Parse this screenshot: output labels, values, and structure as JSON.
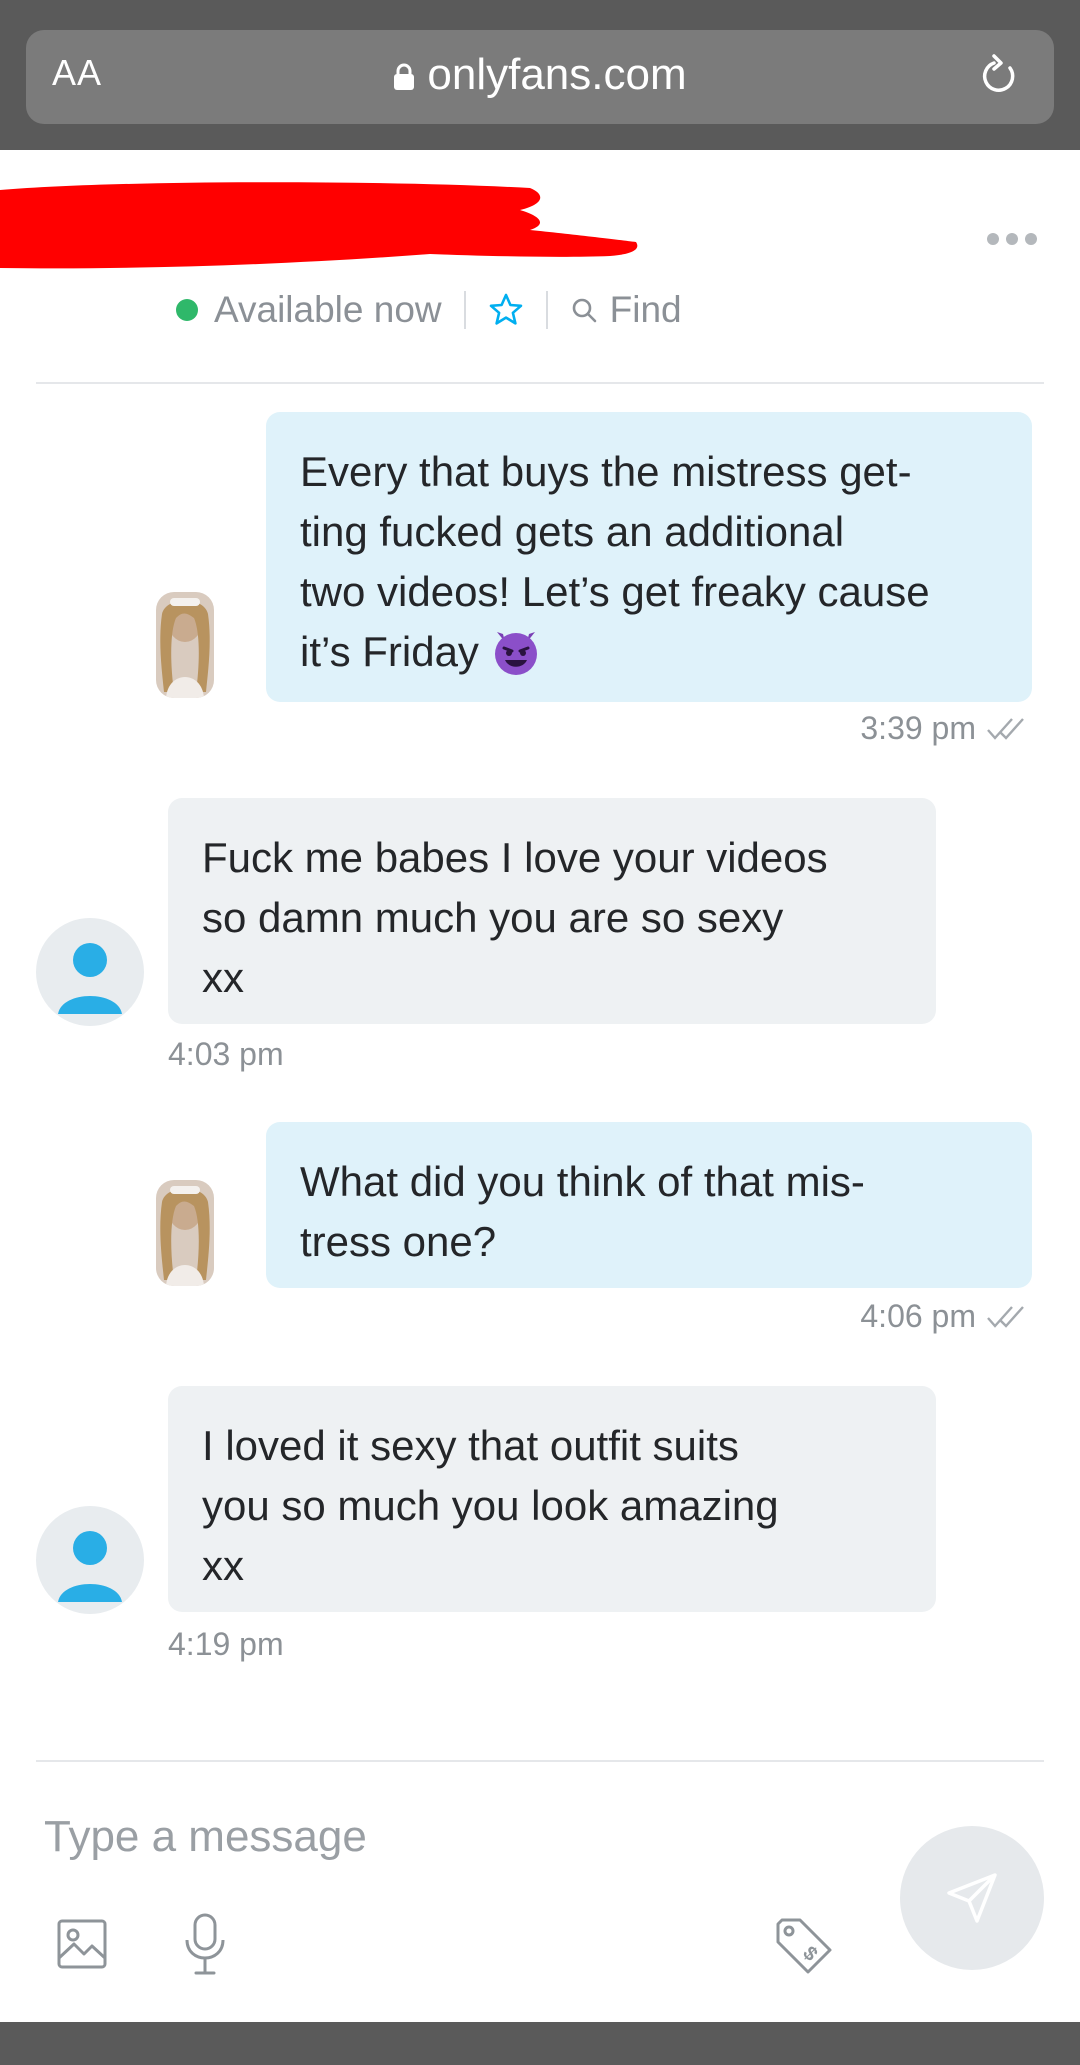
{
  "browser": {
    "reader_label": "AA",
    "url": "onlyfans.com"
  },
  "header": {
    "status_text": "Available now",
    "find_label": "Find"
  },
  "messages": [
    {
      "direction": "outgoing",
      "text": "Every that buys the mistress get-\nting fucked gets an additional\ntwo videos! Let’s get freaky cause\nit’s Friday",
      "emoji": "smiling-devil-emoji",
      "time": "3:39 pm",
      "read": true
    },
    {
      "direction": "incoming",
      "text": "Fuck me babes I love your videos\nso damn much you are so sexy\nxx",
      "time": "4:03 pm"
    },
    {
      "direction": "outgoing",
      "text": "What did you think of that mis-\ntress one?",
      "time": "4:06 pm",
      "read": true
    },
    {
      "direction": "incoming",
      "text": "I loved it sexy that outfit suits\nyou so much you look amazing\nxx",
      "time": "4:19 pm"
    }
  ],
  "composer": {
    "placeholder": "Type a message"
  },
  "colors": {
    "outgoing_bubble": "#dff2fa",
    "incoming_bubble": "#eef1f3",
    "online_dot": "#2fb86a",
    "accent_blue": "#00aff0",
    "redaction": "#ff0000"
  },
  "icons": {
    "lock": "lock-icon",
    "reload": "reload-icon",
    "more": "more-dots-icon",
    "favorite": "star-icon",
    "find": "search-icon",
    "read_receipt": "double-check-icon",
    "user": "user-avatar-icon",
    "image": "image-icon",
    "voice": "microphone-icon",
    "price": "price-tag-icon",
    "send": "send-icon"
  }
}
